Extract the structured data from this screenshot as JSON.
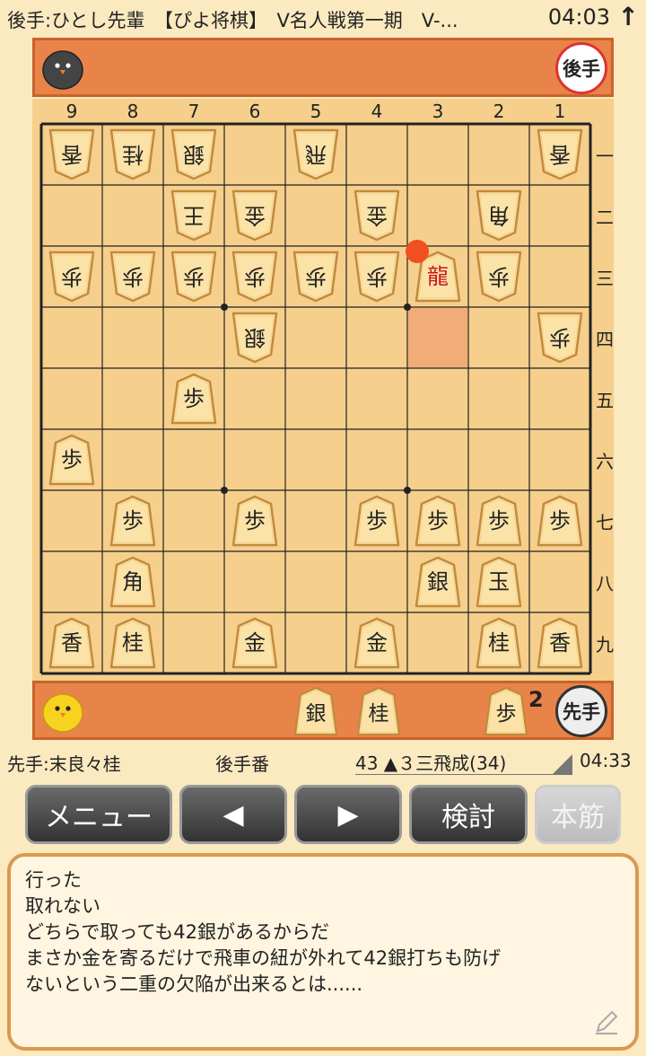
{
  "header": {
    "title": "後手:ひとし先輩　【ぴよ将棋】　V名人戦第一期　V-...",
    "clock": "04:03",
    "up_arrow": "↑"
  },
  "gote_stand": {
    "badge": "後手",
    "avatar": "black-chick-icon"
  },
  "sente_stand": {
    "badge": "先手",
    "avatar": "yellow-chick-icon",
    "hand": [
      {
        "piece": "銀"
      },
      {
        "piece": "桂"
      },
      {
        "piece": "歩",
        "count": "2"
      }
    ]
  },
  "board": {
    "files": [
      "9",
      "8",
      "7",
      "6",
      "5",
      "4",
      "3",
      "2",
      "1"
    ],
    "ranks": [
      "一",
      "二",
      "三",
      "四",
      "五",
      "六",
      "七",
      "八",
      "九"
    ],
    "last_move_from": "34",
    "last_move_to": "33",
    "pieces": [
      {
        "sq": "91",
        "p": "香",
        "side": "gote"
      },
      {
        "sq": "81",
        "p": "桂",
        "side": "gote"
      },
      {
        "sq": "71",
        "p": "銀",
        "side": "gote"
      },
      {
        "sq": "51",
        "p": "飛",
        "side": "gote"
      },
      {
        "sq": "11",
        "p": "香",
        "side": "gote"
      },
      {
        "sq": "72",
        "p": "王",
        "side": "gote"
      },
      {
        "sq": "62",
        "p": "金",
        "side": "gote"
      },
      {
        "sq": "42",
        "p": "金",
        "side": "gote"
      },
      {
        "sq": "22",
        "p": "角",
        "side": "gote"
      },
      {
        "sq": "93",
        "p": "歩",
        "side": "gote"
      },
      {
        "sq": "83",
        "p": "歩",
        "side": "gote"
      },
      {
        "sq": "73",
        "p": "歩",
        "side": "gote"
      },
      {
        "sq": "63",
        "p": "歩",
        "side": "gote"
      },
      {
        "sq": "53",
        "p": "歩",
        "side": "gote"
      },
      {
        "sq": "43",
        "p": "歩",
        "side": "gote"
      },
      {
        "sq": "33",
        "p": "龍",
        "side": "sente",
        "promoted": true
      },
      {
        "sq": "23",
        "p": "歩",
        "side": "gote"
      },
      {
        "sq": "64",
        "p": "銀",
        "side": "gote"
      },
      {
        "sq": "14",
        "p": "歩",
        "side": "gote"
      },
      {
        "sq": "75",
        "p": "歩",
        "side": "sente"
      },
      {
        "sq": "96",
        "p": "歩",
        "side": "sente"
      },
      {
        "sq": "87",
        "p": "歩",
        "side": "sente"
      },
      {
        "sq": "67",
        "p": "歩",
        "side": "sente"
      },
      {
        "sq": "47",
        "p": "歩",
        "side": "sente"
      },
      {
        "sq": "37",
        "p": "歩",
        "side": "sente"
      },
      {
        "sq": "27",
        "p": "歩",
        "side": "sente"
      },
      {
        "sq": "17",
        "p": "歩",
        "side": "sente"
      },
      {
        "sq": "88",
        "p": "角",
        "side": "sente"
      },
      {
        "sq": "38",
        "p": "銀",
        "side": "sente"
      },
      {
        "sq": "28",
        "p": "玉",
        "side": "sente"
      },
      {
        "sq": "99",
        "p": "香",
        "side": "sente"
      },
      {
        "sq": "89",
        "p": "桂",
        "side": "sente"
      },
      {
        "sq": "69",
        "p": "金",
        "side": "sente"
      },
      {
        "sq": "49",
        "p": "金",
        "side": "sente"
      },
      {
        "sq": "29",
        "p": "桂",
        "side": "sente"
      },
      {
        "sq": "19",
        "p": "香",
        "side": "sente"
      }
    ]
  },
  "info": {
    "sente_name": "先手:末良々桂",
    "turn": "後手番",
    "move": "43 ▲３三飛成(34)",
    "clock": "04:33"
  },
  "buttons": {
    "menu": "メニュー",
    "prev": "◀",
    "next": "▶",
    "analyze": "検討",
    "mainline": "本筋"
  },
  "comment": {
    "lines": [
      "行った",
      "取れない",
      "どちらで取っても42銀があるからだ",
      "まさか金を寄るだけで飛車の紐が外れて42銀打ちも防げ",
      "ないという二重の欠陥が出来るとは......"
    ],
    "edit_icon": "pencil-icon"
  },
  "colors": {
    "board": "#f5cf8b",
    "stand": "#e8844a",
    "highlight": "#f0a070",
    "promoted": "#c8181e"
  }
}
